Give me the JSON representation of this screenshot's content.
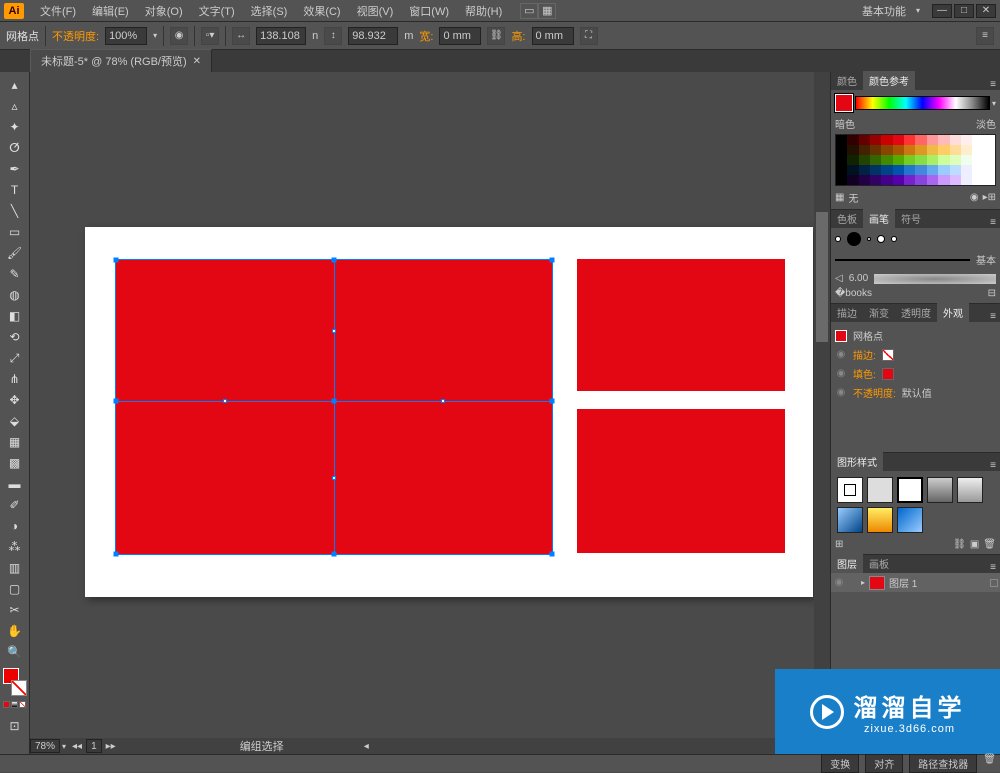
{
  "app": {
    "logo": "Ai"
  },
  "menu": {
    "file": "文件(F)",
    "edit": "编辑(E)",
    "object": "对象(O)",
    "type": "文字(T)",
    "select": "选择(S)",
    "effect": "效果(C)",
    "view": "视图(V)",
    "window": "窗口(W)",
    "help": "帮助(H)"
  },
  "workspace": "基本功能",
  "control": {
    "selection_type": "网格点",
    "opacity_lbl": "不透明度:",
    "opacity_val": "100%",
    "x_val": "138.108",
    "x_unit": "n",
    "y_val": "98.932",
    "y_unit": "m",
    "w_lbl": "宽:",
    "w_val": "0 mm",
    "h_lbl": "高:",
    "h_val": "0 mm"
  },
  "tab": {
    "title": "未标题-5* @ 78% (RGB/预览)"
  },
  "zoom": {
    "val": "78%",
    "page": "1"
  },
  "statusbar": {
    "tool": "编组选择"
  },
  "panels": {
    "color": {
      "tab1": "颜色",
      "tab2": "颜色参考",
      "dark": "暗色",
      "light": "淡色",
      "none": "无"
    },
    "swatch": {
      "tab1": "色板",
      "tab2": "画笔",
      "tab3": "符号",
      "basic": "基本",
      "size": "6.00"
    },
    "stroke": {
      "tab1": "描边",
      "tab2": "渐变",
      "tab3": "透明度",
      "tab4": "外观",
      "title": "网格点",
      "stroke": "描边:",
      "fill": "填色:",
      "opacity": "不透明度:",
      "default": "默认值"
    },
    "gstyle": {
      "tab": "图形样式"
    },
    "layers": {
      "tab1": "图层",
      "tab2": "画板",
      "name": "图层 1"
    }
  },
  "status_btns": {
    "transform": "变换",
    "align": "对齐",
    "pathfinder": "路径查找器"
  },
  "watermark": {
    "ch": "溜溜自学",
    "url": "zixue.3d66.com"
  }
}
